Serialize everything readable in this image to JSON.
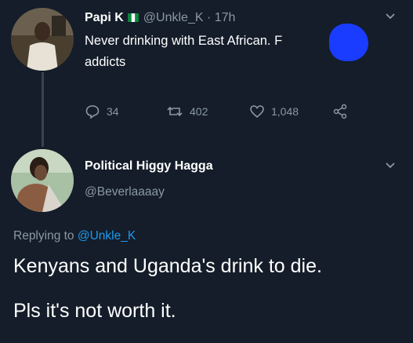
{
  "tweet1": {
    "name": "Papi K",
    "handle": "@Unkle_K",
    "separator": "·",
    "time": "17h",
    "text": "Never drinking with East African. F",
    "text_line2": "addicts",
    "replies": "34",
    "retweets": "402",
    "likes": "1,048",
    "flag_colors": [
      "#0b8a3e",
      "#ffffff",
      "#0b8a3e"
    ]
  },
  "tweet2": {
    "name": "Political Higgy Hagga",
    "handle": "@Beverlaaaay",
    "replying_prefix": "Replying to",
    "replying_mention": "@Unkle_K",
    "line1": "Kenyans and Uganda's drink to die.",
    "line2": "Pls it's not worth it."
  },
  "colors": {
    "background": "#141d29",
    "muted": "#8b98a5",
    "mention": "#1d9bf0",
    "redaction": "#1a3cff"
  },
  "icons": [
    "reply-icon",
    "retweet-icon",
    "like-icon",
    "share-icon",
    "chevron-down-icon"
  ]
}
